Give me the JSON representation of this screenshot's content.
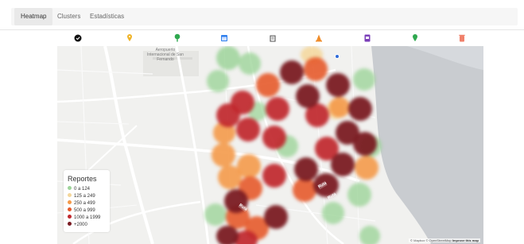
{
  "tabs": [
    {
      "label": "Heatmap",
      "active": true
    },
    {
      "label": "Clusters",
      "active": false
    },
    {
      "label": "Estadísticas",
      "active": false
    }
  ],
  "filters": [
    {
      "name": "circle-all-icon",
      "color": "#111111"
    },
    {
      "name": "pin-icon",
      "color": "#f0b429"
    },
    {
      "name": "tree-icon",
      "color": "#2fa84f"
    },
    {
      "name": "calendar-icon",
      "color": "#2f80ed"
    },
    {
      "name": "building-icon",
      "color": "#555555"
    },
    {
      "name": "cone-icon",
      "color": "#f08c2a"
    },
    {
      "name": "document-icon",
      "color": "#7b3fb8"
    },
    {
      "name": "location-icon",
      "color": "#2fa84f"
    },
    {
      "name": "trash-icon",
      "color": "#f0806a"
    }
  ],
  "map": {
    "airport_label": "Aeropuerto\nInternacional de San\nFernando",
    "attribution": "© Mapbox © OpenStreetMap",
    "improve": "Improve this map",
    "street_tags": [
      "Ruta",
      "Ruta",
      "Ruta"
    ]
  },
  "legend": {
    "title": "Reportes",
    "items": [
      {
        "label": "0 a 124",
        "color": "#9ed49a"
      },
      {
        "label": "125 a 249",
        "color": "#f4d79b"
      },
      {
        "label": "250 a 499",
        "color": "#f49a4a"
      },
      {
        "label": "500 a 999",
        "color": "#e55a2b"
      },
      {
        "label": "1000 a 1999",
        "color": "#c0272d"
      },
      {
        "label": "+2000",
        "color": "#7a1b22"
      }
    ]
  }
}
